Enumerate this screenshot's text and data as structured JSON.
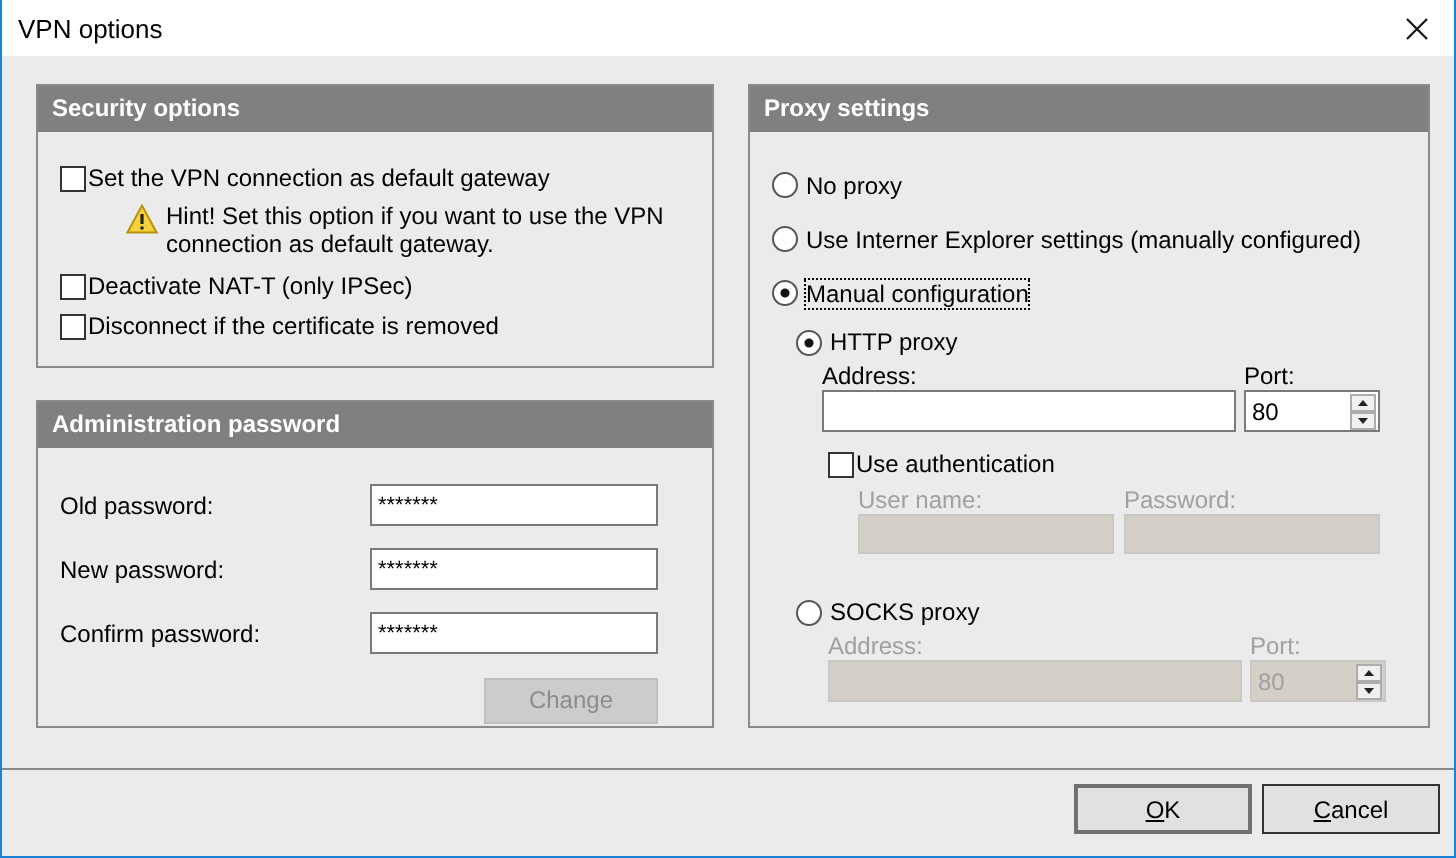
{
  "window": {
    "title": "VPN options"
  },
  "security_options": {
    "title": "Security options",
    "items": [
      {
        "kind": "checkbox",
        "label": "Set the VPN connection as default gateway",
        "checked": false
      },
      {
        "kind": "hint",
        "text": "Hint! Set this option if you want to use the VPN connection as default gateway."
      },
      {
        "kind": "checkbox",
        "label": "Deactivate NAT-T (only IPSec)",
        "checked": false
      },
      {
        "kind": "checkbox",
        "label": "Disconnect if the certificate is removed",
        "checked": false
      }
    ]
  },
  "admin_password": {
    "title": "Administration password",
    "fields": [
      {
        "label": "Old password:",
        "value": "*******"
      },
      {
        "label": "New password:",
        "value": "*******"
      },
      {
        "label": "Confirm password:",
        "value": "*******"
      }
    ],
    "button": {
      "label": "Change",
      "disabled": true
    }
  },
  "proxy_settings": {
    "title": "Proxy settings",
    "options": [
      {
        "label": "No proxy",
        "selected": false,
        "focused": false
      },
      {
        "label": "Use Interner Explorer settings (manually configured)",
        "selected": false,
        "focused": false
      },
      {
        "label": "Manual configuration",
        "selected": true,
        "focused": true
      }
    ],
    "proxy_types": [
      {
        "label": "HTTP proxy",
        "selected": true,
        "disabled": false,
        "address_label": "Address:",
        "port_label": "Port:",
        "port": "80",
        "auth": {
          "label": "Use authentication",
          "checked": false,
          "fields": [
            {
              "label": "User name:",
              "disabled": true
            },
            {
              "label": "Password:",
              "disabled": true
            }
          ]
        }
      },
      {
        "label": "SOCKS proxy",
        "selected": false,
        "disabled": true,
        "address_label": "Address:",
        "port_label": "Port:",
        "port": "80"
      }
    ]
  },
  "buttons": [
    {
      "label": "OK",
      "default": true,
      "mnemonic_underlined": true
    },
    {
      "label": "Cancel",
      "default": false,
      "mnemonic_underlined": true
    }
  ]
}
